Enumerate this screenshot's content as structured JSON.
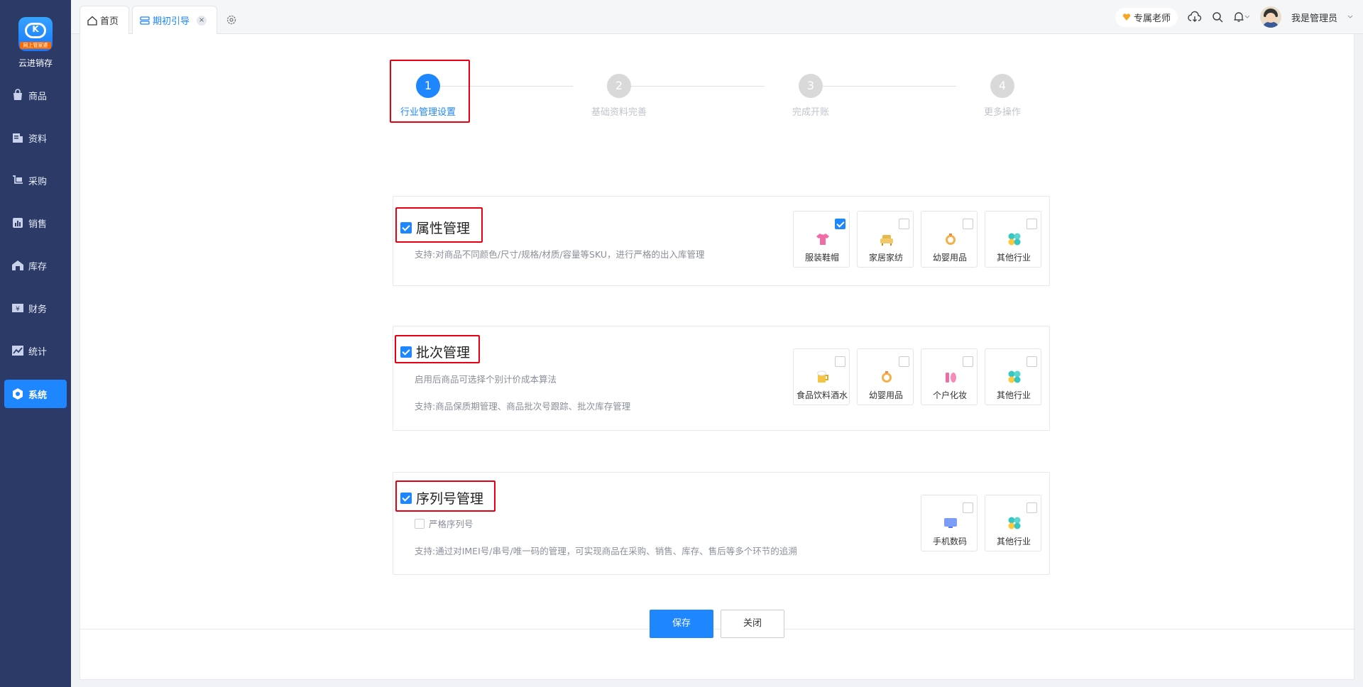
{
  "app": {
    "brand": "云进销存",
    "logo_ribbon": "网上管家婆"
  },
  "sidebar": {
    "items": [
      {
        "label": "商品",
        "icon": "bag-icon"
      },
      {
        "label": "资料",
        "icon": "document-icon"
      },
      {
        "label": "采购",
        "icon": "cart-icon"
      },
      {
        "label": "销售",
        "icon": "bar-chart-icon"
      },
      {
        "label": "库存",
        "icon": "warehouse-icon"
      },
      {
        "label": "财务",
        "icon": "finance-icon"
      },
      {
        "label": "统计",
        "icon": "statistics-icon"
      },
      {
        "label": "系统",
        "icon": "system-icon",
        "active": true
      }
    ]
  },
  "tabs": [
    {
      "label": "首页",
      "icon": "home-icon"
    },
    {
      "label": "期初引导",
      "icon": "guide-icon",
      "active": true,
      "close": "×"
    }
  ],
  "header": {
    "teacher": "专属老师",
    "user": "我是管理员"
  },
  "steps": [
    {
      "num": "1",
      "label": "行业管理设置",
      "active": true
    },
    {
      "num": "2",
      "label": "基础资料完善"
    },
    {
      "num": "3",
      "label": "完成开账"
    },
    {
      "num": "4",
      "label": "更多操作"
    }
  ],
  "sections": {
    "attr": {
      "title": "属性管理",
      "desc": "支持:对商品不同颜色/尺寸/规格/材质/容量等SKU，进行严格的出入库管理",
      "industries": [
        {
          "label": "服装鞋帽",
          "checked": true,
          "icon": "clothing-icon"
        },
        {
          "label": "家居家纺",
          "checked": false,
          "icon": "sofa-icon"
        },
        {
          "label": "幼婴用品",
          "checked": false,
          "icon": "baby-icon"
        },
        {
          "label": "其他行业",
          "checked": false,
          "icon": "other-icon"
        }
      ]
    },
    "batch": {
      "title": "批次管理",
      "desc1": "启用后商品可选择个别计价成本算法",
      "desc2": "支持:商品保质期管理、商品批次号跟踪、批次库存管理",
      "industries": [
        {
          "label": "食品饮料酒水",
          "checked": false,
          "icon": "beer-icon"
        },
        {
          "label": "幼婴用品",
          "checked": false,
          "icon": "baby-icon"
        },
        {
          "label": "个户化妆",
          "checked": false,
          "icon": "cosmetics-icon"
        },
        {
          "label": "其他行业",
          "checked": false,
          "icon": "other-icon"
        }
      ]
    },
    "serial": {
      "title": "序列号管理",
      "strict": "严格序列号",
      "desc": "支持:通过对IMEI号/串号/唯一码的管理，可实现商品在采购、销售、库存、售后等多个环节的追溯",
      "industries": [
        {
          "label": "手机数码",
          "checked": false,
          "icon": "monitor-icon"
        },
        {
          "label": "其他行业",
          "checked": false,
          "icon": "other-icon"
        }
      ]
    }
  },
  "footer": {
    "save": "保存",
    "close": "关闭"
  }
}
